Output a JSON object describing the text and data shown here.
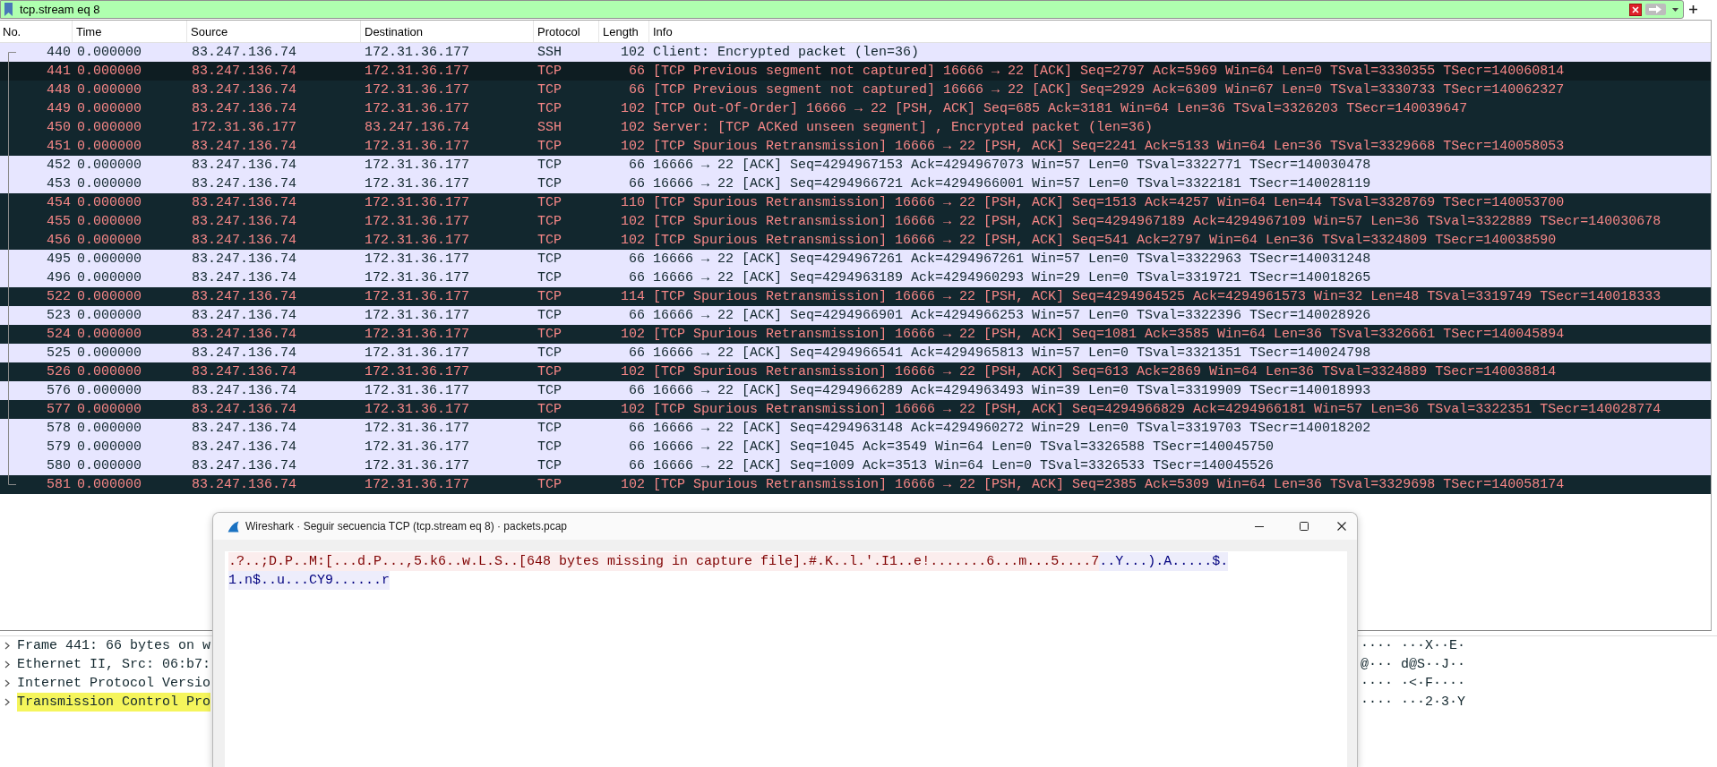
{
  "display_filter": {
    "value": "tcp.stream eq 8"
  },
  "packet_list": {
    "columns": [
      "No.",
      "Time",
      "Source",
      "Destination",
      "Protocol",
      "Length",
      "Info"
    ],
    "rows": [
      {
        "no": "440",
        "time": "0.000000",
        "source": "83.247.136.74",
        "destination": "172.31.36.177",
        "protocol": "SSH",
        "length": "102",
        "info": "Client: Encrypted packet (len=36)",
        "kind": "normal",
        "selected": false
      },
      {
        "no": "441",
        "time": "0.000000",
        "source": "83.247.136.74",
        "destination": "172.31.36.177",
        "protocol": "TCP",
        "length": "66",
        "info": "[TCP Previous segment not captured] 16666 → 22 [ACK] Seq=2797 Ack=5969 Win=64 Len=0 TSval=3330355 TSecr=140060814",
        "kind": "bad",
        "selected": true
      },
      {
        "no": "448",
        "time": "0.000000",
        "source": "83.247.136.74",
        "destination": "172.31.36.177",
        "protocol": "TCP",
        "length": "66",
        "info": "[TCP Previous segment not captured] 16666 → 22 [ACK] Seq=2929 Ack=6309 Win=67 Len=0 TSval=3330733 TSecr=140062327",
        "kind": "bad",
        "selected": false
      },
      {
        "no": "449",
        "time": "0.000000",
        "source": "83.247.136.74",
        "destination": "172.31.36.177",
        "protocol": "TCP",
        "length": "102",
        "info": "[TCP Out-Of-Order] 16666 → 22 [PSH, ACK] Seq=685 Ack=3181 Win=64 Len=36 TSval=3326203 TSecr=140039647",
        "kind": "bad",
        "selected": false
      },
      {
        "no": "450",
        "time": "0.000000",
        "source": "172.31.36.177",
        "destination": "83.247.136.74",
        "protocol": "SSH",
        "length": "102",
        "info": "Server: [TCP ACKed unseen segment] , Encrypted packet (len=36)",
        "kind": "bad",
        "selected": false
      },
      {
        "no": "451",
        "time": "0.000000",
        "source": "83.247.136.74",
        "destination": "172.31.36.177",
        "protocol": "TCP",
        "length": "102",
        "info": "[TCP Spurious Retransmission] 16666 → 22 [PSH, ACK] Seq=2241 Ack=5133 Win=64 Len=36 TSval=3329668 TSecr=140058053",
        "kind": "bad",
        "selected": false
      },
      {
        "no": "452",
        "time": "0.000000",
        "source": "83.247.136.74",
        "destination": "172.31.36.177",
        "protocol": "TCP",
        "length": "66",
        "info": "16666 → 22 [ACK] Seq=4294967153 Ack=4294967073 Win=57 Len=0 TSval=3322771 TSecr=140030478",
        "kind": "normal",
        "selected": false
      },
      {
        "no": "453",
        "time": "0.000000",
        "source": "83.247.136.74",
        "destination": "172.31.36.177",
        "protocol": "TCP",
        "length": "66",
        "info": "16666 → 22 [ACK] Seq=4294966721 Ack=4294966001 Win=57 Len=0 TSval=3322181 TSecr=140028119",
        "kind": "normal",
        "selected": false
      },
      {
        "no": "454",
        "time": "0.000000",
        "source": "83.247.136.74",
        "destination": "172.31.36.177",
        "protocol": "TCP",
        "length": "110",
        "info": "[TCP Spurious Retransmission] 16666 → 22 [PSH, ACK] Seq=1513 Ack=4257 Win=64 Len=44 TSval=3328769 TSecr=140053700",
        "kind": "bad",
        "selected": false
      },
      {
        "no": "455",
        "time": "0.000000",
        "source": "83.247.136.74",
        "destination": "172.31.36.177",
        "protocol": "TCP",
        "length": "102",
        "info": "[TCP Spurious Retransmission] 16666 → 22 [PSH, ACK] Seq=4294967189 Ack=4294967109 Win=57 Len=36 TSval=3322889 TSecr=140030678",
        "kind": "bad",
        "selected": false
      },
      {
        "no": "456",
        "time": "0.000000",
        "source": "83.247.136.74",
        "destination": "172.31.36.177",
        "protocol": "TCP",
        "length": "102",
        "info": "[TCP Spurious Retransmission] 16666 → 22 [PSH, ACK] Seq=541 Ack=2797 Win=64 Len=36 TSval=3324809 TSecr=140038590",
        "kind": "bad",
        "selected": false
      },
      {
        "no": "495",
        "time": "0.000000",
        "source": "83.247.136.74",
        "destination": "172.31.36.177",
        "protocol": "TCP",
        "length": "66",
        "info": "16666 → 22 [ACK] Seq=4294967261 Ack=4294967261 Win=57 Len=0 TSval=3322963 TSecr=140031248",
        "kind": "normal",
        "selected": false
      },
      {
        "no": "496",
        "time": "0.000000",
        "source": "83.247.136.74",
        "destination": "172.31.36.177",
        "protocol": "TCP",
        "length": "66",
        "info": "16666 → 22 [ACK] Seq=4294963189 Ack=4294960293 Win=29 Len=0 TSval=3319721 TSecr=140018265",
        "kind": "normal",
        "selected": false
      },
      {
        "no": "522",
        "time": "0.000000",
        "source": "83.247.136.74",
        "destination": "172.31.36.177",
        "protocol": "TCP",
        "length": "114",
        "info": "[TCP Spurious Retransmission] 16666 → 22 [PSH, ACK] Seq=4294964525 Ack=4294961573 Win=32 Len=48 TSval=3319749 TSecr=140018333",
        "kind": "bad",
        "selected": false
      },
      {
        "no": "523",
        "time": "0.000000",
        "source": "83.247.136.74",
        "destination": "172.31.36.177",
        "protocol": "TCP",
        "length": "66",
        "info": "16666 → 22 [ACK] Seq=4294966901 Ack=4294966253 Win=57 Len=0 TSval=3322396 TSecr=140028926",
        "kind": "normal",
        "selected": false
      },
      {
        "no": "524",
        "time": "0.000000",
        "source": "83.247.136.74",
        "destination": "172.31.36.177",
        "protocol": "TCP",
        "length": "102",
        "info": "[TCP Spurious Retransmission] 16666 → 22 [PSH, ACK] Seq=1081 Ack=3585 Win=64 Len=36 TSval=3326661 TSecr=140045894",
        "kind": "bad",
        "selected": false
      },
      {
        "no": "525",
        "time": "0.000000",
        "source": "83.247.136.74",
        "destination": "172.31.36.177",
        "protocol": "TCP",
        "length": "66",
        "info": "16666 → 22 [ACK] Seq=4294966541 Ack=4294965813 Win=57 Len=0 TSval=3321351 TSecr=140024798",
        "kind": "normal",
        "selected": false
      },
      {
        "no": "526",
        "time": "0.000000",
        "source": "83.247.136.74",
        "destination": "172.31.36.177",
        "protocol": "TCP",
        "length": "102",
        "info": "[TCP Spurious Retransmission] 16666 → 22 [PSH, ACK] Seq=613 Ack=2869 Win=64 Len=36 TSval=3324889 TSecr=140038814",
        "kind": "bad",
        "selected": false
      },
      {
        "no": "576",
        "time": "0.000000",
        "source": "83.247.136.74",
        "destination": "172.31.36.177",
        "protocol": "TCP",
        "length": "66",
        "info": "16666 → 22 [ACK] Seq=4294966289 Ack=4294963493 Win=39 Len=0 TSval=3319909 TSecr=140018993",
        "kind": "normal",
        "selected": false
      },
      {
        "no": "577",
        "time": "0.000000",
        "source": "83.247.136.74",
        "destination": "172.31.36.177",
        "protocol": "TCP",
        "length": "102",
        "info": "[TCP Spurious Retransmission] 16666 → 22 [PSH, ACK] Seq=4294966829 Ack=4294966181 Win=57 Len=36 TSval=3322351 TSecr=140028774",
        "kind": "bad",
        "selected": false
      },
      {
        "no": "578",
        "time": "0.000000",
        "source": "83.247.136.74",
        "destination": "172.31.36.177",
        "protocol": "TCP",
        "length": "66",
        "info": "16666 → 22 [ACK] Seq=4294963148 Ack=4294960272 Win=29 Len=0 TSval=3319703 TSecr=140018202",
        "kind": "normal",
        "selected": false
      },
      {
        "no": "579",
        "time": "0.000000",
        "source": "83.247.136.74",
        "destination": "172.31.36.177",
        "protocol": "TCP",
        "length": "66",
        "info": "16666 → 22 [ACK] Seq=1045 Ack=3549 Win=64 Len=0 TSval=3326588 TSecr=140045750",
        "kind": "normal",
        "selected": false
      },
      {
        "no": "580",
        "time": "0.000000",
        "source": "83.247.136.74",
        "destination": "172.31.36.177",
        "protocol": "TCP",
        "length": "66",
        "info": "16666 → 22 [ACK] Seq=1009 Ack=3513 Win=64 Len=0 TSval=3326533 TSecr=140045526",
        "kind": "normal",
        "selected": false
      },
      {
        "no": "581",
        "time": "0.000000",
        "source": "83.247.136.74",
        "destination": "172.31.36.177",
        "protocol": "TCP",
        "length": "102",
        "info": "[TCP Spurious Retransmission] 16666 → 22 [PSH, ACK] Seq=2385 Ack=5309 Win=64 Len=36 TSval=3329698 TSecr=140058174",
        "kind": "bad",
        "selected": false
      }
    ]
  },
  "packet_details": [
    {
      "label": "Frame 441: 66 bytes on w",
      "expanded": false,
      "warning": false
    },
    {
      "label": "Ethernet II, Src: 06:b7:",
      "expanded": false,
      "warning": false
    },
    {
      "label": "Internet Protocol Versio",
      "expanded": false,
      "warning": false
    },
    {
      "label": "Transmission Control Pro",
      "expanded": false,
      "warning": true
    }
  ],
  "packet_bytes": {
    "ascii_lines": [
      "···· ···X··E·",
      "@··· d@S··J··",
      "···· ·<·F····",
      "···· ···2·3·Y"
    ]
  },
  "follow_stream_dialog": {
    "title": "Wireshark · Seguir secuencia TCP (tcp.stream eq 8) · packets.pcap",
    "lines": [
      {
        "segments": [
          {
            "kind": "client",
            "text": ".?..;D.P..M:[...d.P...,5.k6..w.L.S..[648 bytes missing in capture file].#.K..l.'.I1..e!.......6...m...5....7"
          },
          {
            "kind": "server",
            "text": "..Y...).A.....$."
          }
        ]
      },
      {
        "segments": [
          {
            "kind": "server",
            "text": "1.n$..u...CY9......r"
          }
        ]
      }
    ]
  }
}
